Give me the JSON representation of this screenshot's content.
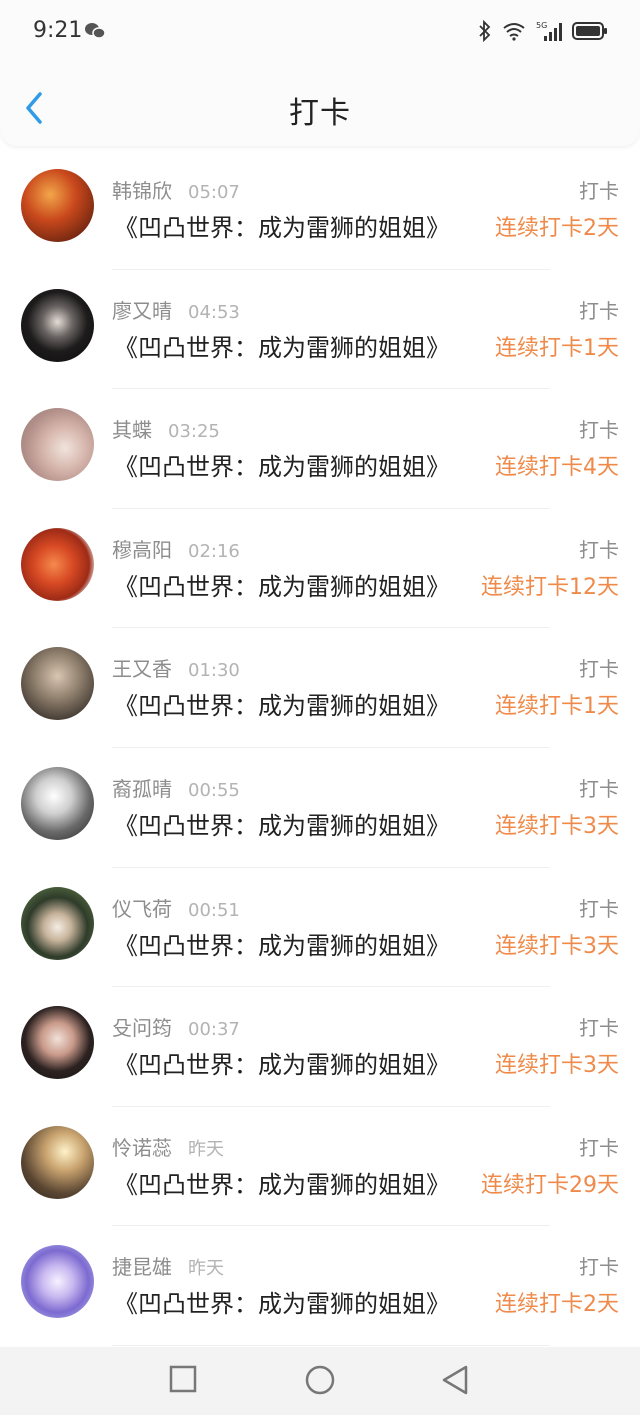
{
  "status_bar": {
    "time": "9:21"
  },
  "header": {
    "title": "打卡"
  },
  "rows": [
    {
      "name": "韩锦欣",
      "time": "05:07",
      "book": "《凹凸世界：成为雷狮的姐姐》",
      "action": "打卡",
      "streak": "连续打卡2天"
    },
    {
      "name": "廖又晴",
      "time": "04:53",
      "book": "《凹凸世界：成为雷狮的姐姐》",
      "action": "打卡",
      "streak": "连续打卡1天"
    },
    {
      "name": "其蝶",
      "time": "03:25",
      "book": "《凹凸世界：成为雷狮的姐姐》",
      "action": "打卡",
      "streak": "连续打卡4天"
    },
    {
      "name": "穆高阳",
      "time": "02:16",
      "book": "《凹凸世界：成为雷狮的姐姐》",
      "action": "打卡",
      "streak": "连续打卡12天"
    },
    {
      "name": "王又香",
      "time": "01:30",
      "book": "《凹凸世界：成为雷狮的姐姐》",
      "action": "打卡",
      "streak": "连续打卡1天"
    },
    {
      "name": "裔孤晴",
      "time": "00:55",
      "book": "《凹凸世界：成为雷狮的姐姐》",
      "action": "打卡",
      "streak": "连续打卡3天"
    },
    {
      "name": "仪飞荷",
      "time": "00:51",
      "book": "《凹凸世界：成为雷狮的姐姐》",
      "action": "打卡",
      "streak": "连续打卡3天"
    },
    {
      "name": "殳问筠",
      "time": "00:37",
      "book": "《凹凸世界：成为雷狮的姐姐》",
      "action": "打卡",
      "streak": "连续打卡3天"
    },
    {
      "name": "怜诺蕊",
      "time": "昨天",
      "book": "《凹凸世界：成为雷狮的姐姐》",
      "action": "打卡",
      "streak": "连续打卡29天"
    },
    {
      "name": "捷昆雄",
      "time": "昨天",
      "book": "《凹凸世界：成为雷狮的姐姐》",
      "action": "打卡",
      "streak": "连续打卡2天"
    }
  ],
  "colors": {
    "accent": "#ef8a4a",
    "back_arrow": "#2f9be8"
  }
}
